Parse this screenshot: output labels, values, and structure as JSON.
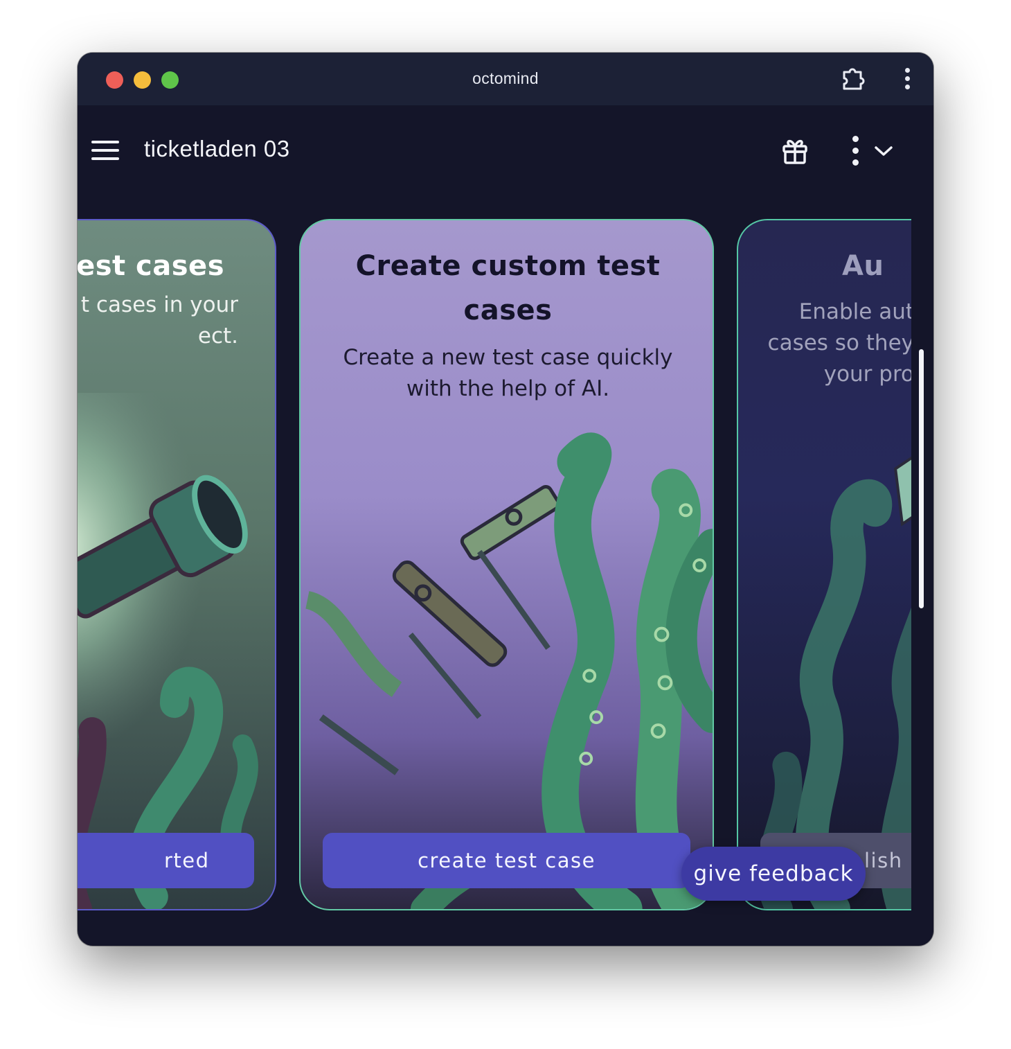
{
  "window": {
    "title": "octomind"
  },
  "appbar": {
    "project_name": "ticketladen 03"
  },
  "cards": [
    {
      "title": "est cases",
      "description": "t cases in your ect.",
      "description_lines": [
        "t cases in your",
        "ect."
      ],
      "button_label": "rted"
    },
    {
      "title": "Create custom test cases",
      "title_lines": [
        "Create custom test",
        "cases"
      ],
      "description": "Create a new test case quickly with the help of AI.",
      "description_lines": [
        "Create a new test case quickly",
        "with the help of AI."
      ],
      "button_label": "create test case"
    },
    {
      "title": "Au",
      "description": "Enable aut cases so they your pro",
      "description_lines": [
        "Enable aut",
        "cases so they",
        "your pro"
      ],
      "button_label": "lish c"
    }
  ],
  "feedback_button": {
    "label": "give feedback"
  },
  "colors": {
    "background": "#141529",
    "titlebar": "#1c2136",
    "accent": "#5150c2",
    "card_border_teal": "#63c9a5",
    "card_border_purple": "#5c5bc9"
  }
}
